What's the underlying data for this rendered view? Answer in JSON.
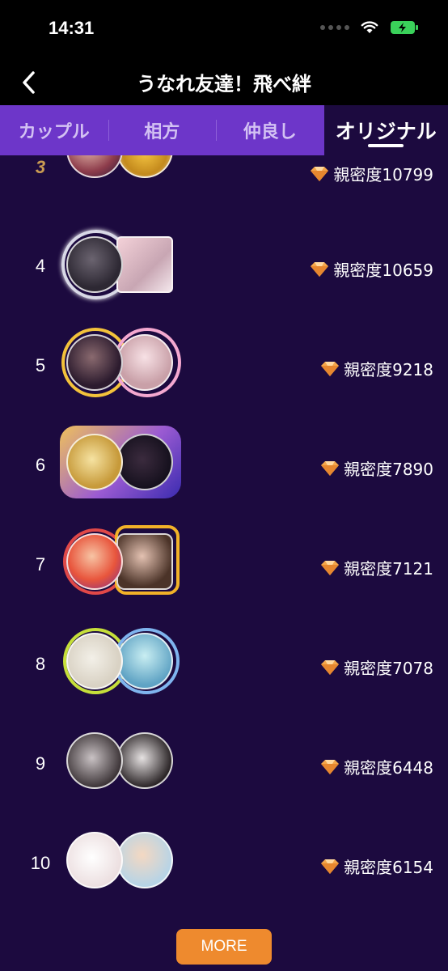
{
  "status_bar": {
    "time": "14:31"
  },
  "nav": {
    "title": "うなれ友達！飛べ絆"
  },
  "tabs": [
    {
      "label": "カップル",
      "active": false
    },
    {
      "label": "相方",
      "active": false
    },
    {
      "label": "仲良し",
      "active": false
    },
    {
      "label": "オリジナル",
      "active": true
    }
  ],
  "rows": [
    {
      "rank": "3",
      "intimacy_label": "親密度10799"
    },
    {
      "rank": "4",
      "intimacy_label": "親密度10659"
    },
    {
      "rank": "5",
      "intimacy_label": "親密度9218"
    },
    {
      "rank": "6",
      "intimacy_label": "親密度7890"
    },
    {
      "rank": "7",
      "intimacy_label": "親密度7121"
    },
    {
      "rank": "8",
      "intimacy_label": "親密度7078"
    },
    {
      "rank": "9",
      "intimacy_label": "親密度6448"
    },
    {
      "rank": "10",
      "intimacy_label": "親密度6154"
    }
  ],
  "more_button": {
    "label": "MORE"
  },
  "colors": {
    "background": "#1c0a3f",
    "tab_bar": "#6d36c9",
    "more_button": "#ee8a2e",
    "gem": "#f5a64a"
  }
}
